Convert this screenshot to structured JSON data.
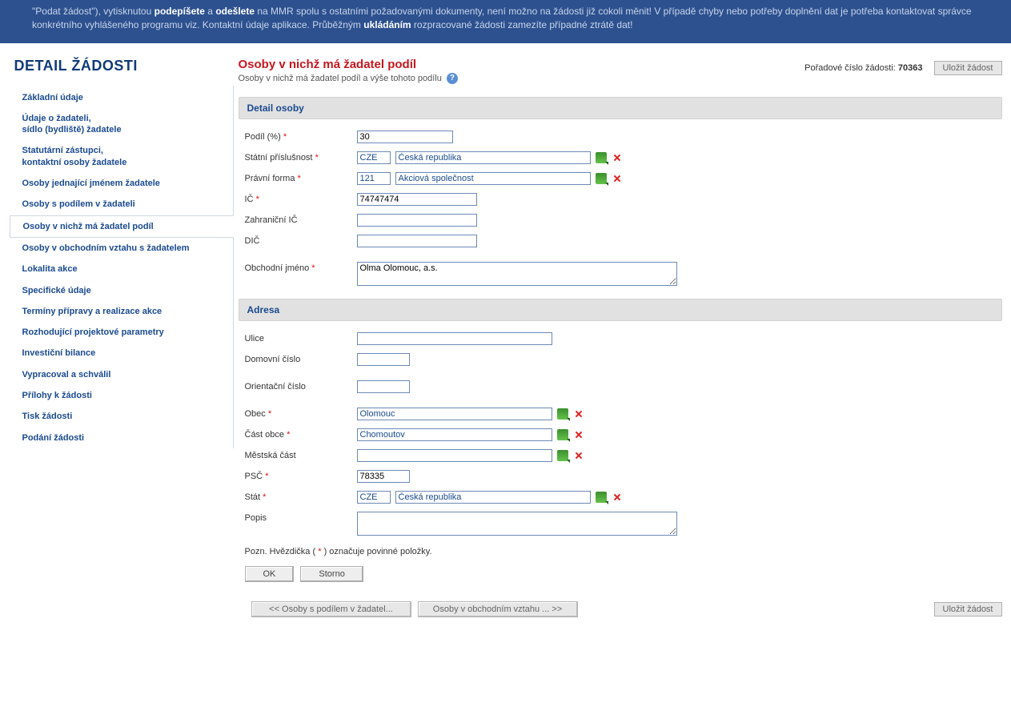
{
  "topbar": {
    "html": "\"Podat žádost\"), vytisknutou <b>podepíšete</b> a <b>odešlete</b> na MMR spolu s ostatními požadovanými dokumenty, není možno na žádosti již cokoli měnit! V případě chyby nebo potřeby doplnění dat je potřeba kontaktovat správce konkrétního vyhlášeného programu viz. Kontaktní údaje aplikace. Průběžným <b>ukládáním</b> rozpracované žádosti zamezíte případné ztrátě dat!"
  },
  "sidebar": {
    "title": "DETAIL ŽÁDOSTI",
    "items": [
      "Základní údaje",
      "Údaje o žadateli,\nsídlo (bydliště) žadatele",
      "Statutární zástupci,\nkontaktní osoby žadatele",
      "Osoby jednající jménem žadatele",
      "Osoby s podílem v žadateli",
      "Osoby v nichž má žadatel podíl",
      "Osoby v obchodním vztahu s žadatelem",
      "Lokalita akce",
      "Specifické údaje",
      "Termíny přípravy a realizace akce",
      "Rozhodující projektové parametry",
      "Investiční bilance",
      "Vypracoval a schválil",
      "Přílohy k žádosti",
      "Tisk žádosti",
      "Podání žádosti"
    ],
    "activeIndex": 5
  },
  "header": {
    "title": "Osoby v nichž má žadatel podíl",
    "subtitle": "Osoby v nichž má žadatel podíl a výše tohoto podílu",
    "order_label": "Pořadové číslo žádosti:",
    "order_value": "70363",
    "save_btn": "Uložit žádost"
  },
  "form": {
    "section1": "Detail osoby",
    "section2": "Adresa",
    "labels": {
      "podil": "Podíl (%)",
      "prislusnost": "Státní příslušnost",
      "forma": "Právní forma",
      "ic": "IČ",
      "zahr_ic": "Zahraniční IČ",
      "dic": "DIČ",
      "obch_jmeno": "Obchodní jméno",
      "ulice": "Ulice",
      "dom_cislo": "Domovní číslo",
      "or_cislo": "Orientační číslo",
      "obec": "Obec",
      "cast_obce": "Část obce",
      "mestska_cast": "Městská část",
      "psc": "PSČ",
      "stat": "Stát",
      "popis": "Popis"
    },
    "values": {
      "podil": "30",
      "prislusnost_code": "CZE",
      "prislusnost_text": "Česká republika",
      "forma_code": "121",
      "forma_text": "Akciová společnost",
      "ic": "74747474",
      "zahr_ic": "",
      "dic": "",
      "obch_jmeno": "Olma Olomouc, a.s.",
      "ulice": "",
      "dom_cislo": "",
      "or_cislo": "",
      "obec": "Olomouc",
      "cast_obce": "Chomoutov",
      "mestska_cast": "",
      "psc": "78335",
      "stat_code": "CZE",
      "stat_text": "Česká republika",
      "popis": ""
    },
    "note_pre": "Pozn. Hvězdička (",
    "note_post": ") označuje povinné položky.",
    "ok": "OK",
    "storno": "Storno"
  },
  "footer": {
    "prev": "<<   Osoby s podílem v žadatel...",
    "next": "Osoby v obchodním vztahu ...   >>",
    "save": "Uložit žádost"
  }
}
